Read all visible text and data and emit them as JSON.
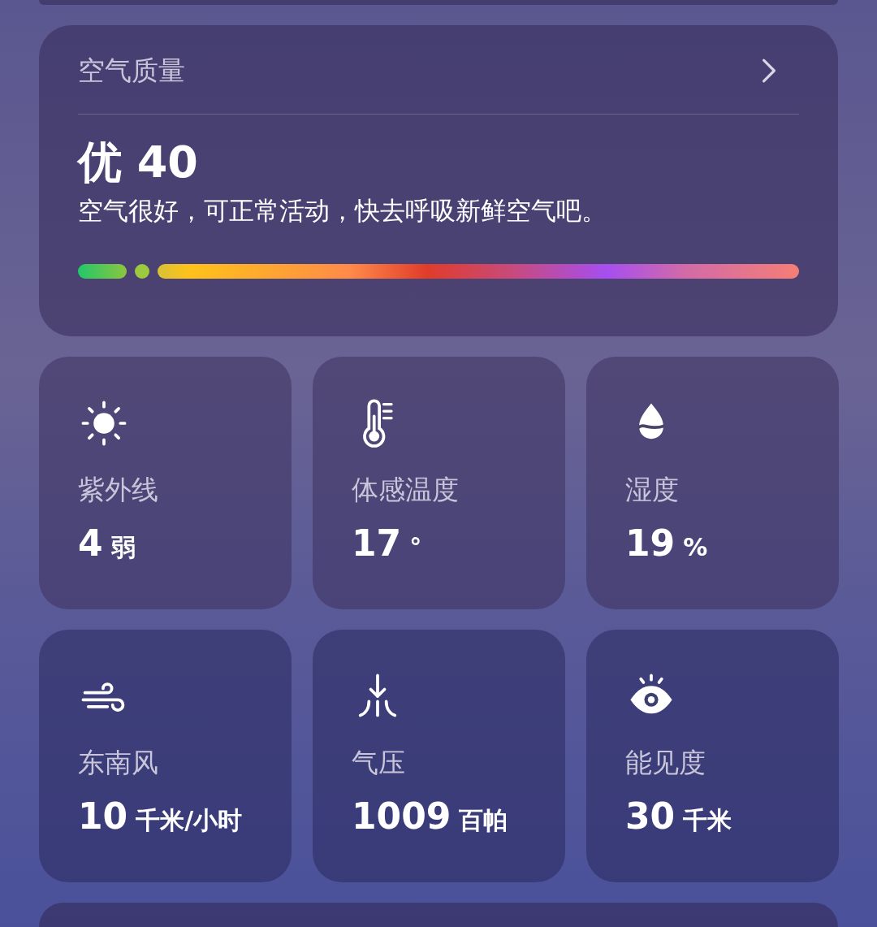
{
  "air_quality": {
    "title": "空气质量",
    "level_name": "优",
    "aqi": "40",
    "description": "空气很好，可正常活动，快去呼吸新鲜空气吧。"
  },
  "tiles": [
    {
      "kind": "uv",
      "label": "紫外线",
      "value": "4",
      "unit": "弱"
    },
    {
      "kind": "feels_like",
      "label": "体感温度",
      "value": "17",
      "unit": "°"
    },
    {
      "kind": "humidity",
      "label": "湿度",
      "value": "19",
      "unit": "%"
    },
    {
      "kind": "wind",
      "label": "东南风",
      "value": "10",
      "unit": "千米/小时"
    },
    {
      "kind": "pressure",
      "label": "气压",
      "value": "1009",
      "unit": "百帕"
    },
    {
      "kind": "visibility",
      "label": "能见度",
      "value": "30",
      "unit": "千米"
    }
  ]
}
